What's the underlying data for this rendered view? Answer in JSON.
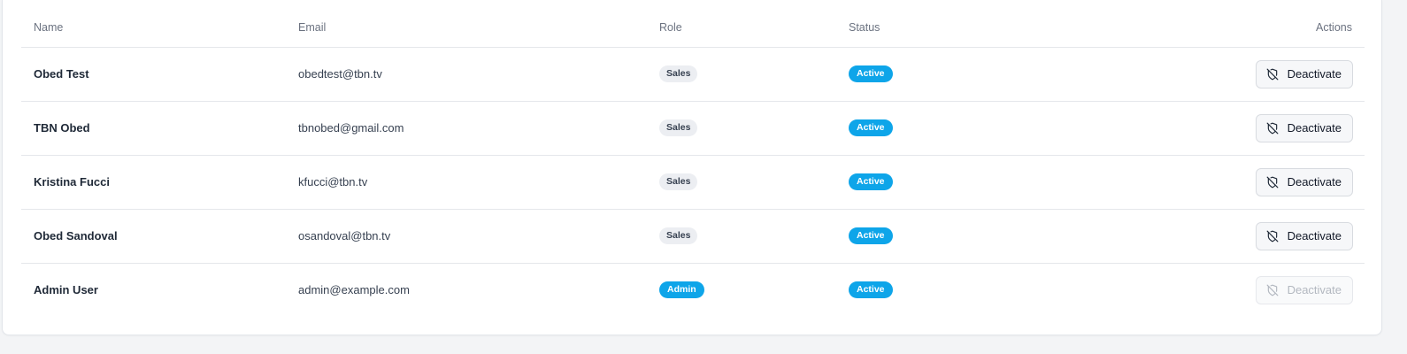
{
  "table": {
    "headers": {
      "name": "Name",
      "email": "Email",
      "role": "Role",
      "status": "Status",
      "actions": "Actions"
    },
    "rows": [
      {
        "name": "Obed Test",
        "email": "obedtest@tbn.tv",
        "role": "Sales",
        "status": "Active",
        "action": "Deactivate",
        "action_enabled": true
      },
      {
        "name": "TBN Obed",
        "email": "tbnobed@gmail.com",
        "role": "Sales",
        "status": "Active",
        "action": "Deactivate",
        "action_enabled": true
      },
      {
        "name": "Kristina Fucci",
        "email": "kfucci@tbn.tv",
        "role": "Sales",
        "status": "Active",
        "action": "Deactivate",
        "action_enabled": true
      },
      {
        "name": "Obed Sandoval",
        "email": "osandoval@tbn.tv",
        "role": "Sales",
        "status": "Active",
        "action": "Deactivate",
        "action_enabled": true
      },
      {
        "name": "Admin User",
        "email": "admin@example.com",
        "role": "Admin",
        "status": "Active",
        "action": "Deactivate",
        "action_enabled": false
      }
    ]
  },
  "icons": {
    "deactivate": "shield-off-icon"
  },
  "colors": {
    "accent": "#0ea5e9",
    "sales_badge_bg": "#eceef2"
  }
}
